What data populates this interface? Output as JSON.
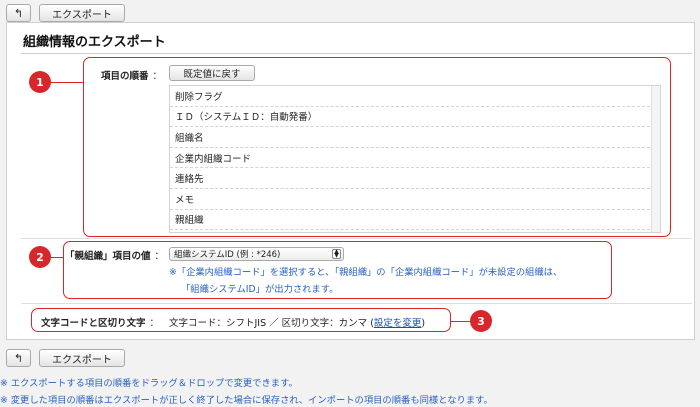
{
  "toolbar": {
    "back_icon": "back-arrow-icon",
    "back_glyph": "↰",
    "export_label": "エクスポート"
  },
  "page": {
    "title": "組織情報のエクスポート"
  },
  "order_section": {
    "badge": "1",
    "label": "項目の順番",
    "separator": "：",
    "reset_button": "既定値に戻す",
    "items": [
      "削除フラグ",
      "ＩＤ（システムＩＤ：自動発番）",
      "組織名",
      "企業内組織コード",
      "連絡先",
      "メモ",
      "親組織"
    ]
  },
  "parent_section": {
    "badge": "2",
    "label": "「親組織」項目の値",
    "separator": "：",
    "selected_option": "組織システムID (例 : *246)",
    "note_line1": "※「企業内組織コード」を選択すると、「親組織」の「企業内組織コード」が未設定の組織は、",
    "note_line2": "「組織システムID」が出力されます。"
  },
  "encoding_section": {
    "badge": "3",
    "label": "文字コードと区切り文字",
    "separator": "：",
    "value": "文字コード：シフトJIS ／ 区切り文字：カンマ (",
    "link": "設定を変更",
    "close": ")"
  },
  "footer": {
    "note1": "※ エクスポートする項目の順番をドラッグ＆ドロップで変更できます。",
    "note2": "※ 変更した項目の順番はエクスポートが正しく終了した場合に保存され、インポートの項目の順番も同様となります。"
  },
  "colors": {
    "highlight": "#d9262b",
    "note": "#2a62c4",
    "link": "#1a4fb3"
  }
}
